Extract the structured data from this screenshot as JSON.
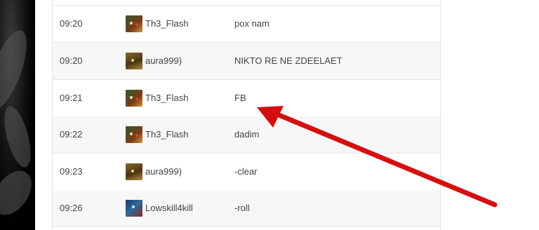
{
  "rows": [
    {
      "time": "09:20",
      "player": "Th3_Flash",
      "avatar_icon": "hero-flash-icon",
      "message": "pox nam"
    },
    {
      "time": "09:20",
      "player": "aura999)",
      "avatar_icon": "hero-aura-icon",
      "message": "NIKTO RE NE ZDEELAET"
    },
    {
      "time": "09:21",
      "player": "Th3_Flash",
      "avatar_icon": "hero-flash-icon",
      "message": "FB"
    },
    {
      "time": "09:22",
      "player": "Th3_Flash",
      "avatar_icon": "hero-flash-icon",
      "message": "dadim"
    },
    {
      "time": "09:23",
      "player": "aura999)",
      "avatar_icon": "hero-aura-icon",
      "message": "-clear"
    },
    {
      "time": "09:26",
      "player": "Lowskill4kill",
      "avatar_icon": "hero-lowskill-icon",
      "message": "-roll"
    }
  ],
  "colors": {
    "arrow": "#d40f10",
    "row_alt": "#f7f7f7",
    "text": "#444444"
  }
}
